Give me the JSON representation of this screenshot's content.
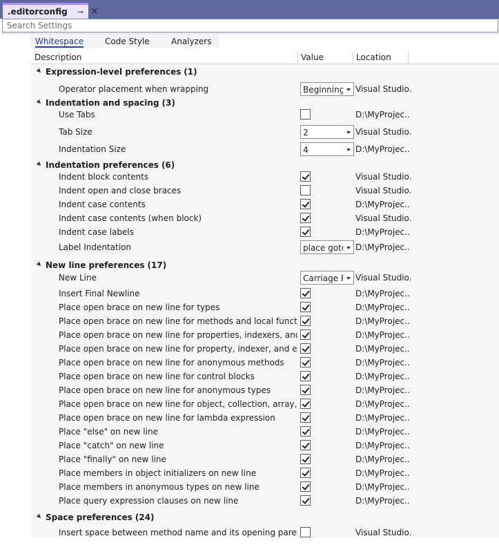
{
  "tab": {
    "title": ".editorconfig",
    "pin": "⊸",
    "close": "✕"
  },
  "search": {
    "placeholder": "Search Settings"
  },
  "tabs": [
    "Whitespace",
    "Code Style",
    "Analyzers"
  ],
  "columns": {
    "description": "Description",
    "value": "Value",
    "location": "Location"
  },
  "groups": [
    {
      "title": "Expression-level preferences",
      "count": "(1)",
      "items": [
        {
          "label": "Operator placement when wrapping",
          "type": "select",
          "value": "Beginning",
          "location": "Visual Studio..."
        }
      ]
    },
    {
      "title": "Indentation and spacing",
      "count": "(3)",
      "items": [
        {
          "label": "Use Tabs",
          "type": "check",
          "checked": false,
          "location": "D:\\MyProjec..."
        },
        {
          "label": "Tab Size",
          "type": "select",
          "value": "2",
          "location": "Visual Studio..."
        },
        {
          "label": "Indentation Size",
          "type": "select",
          "value": "4",
          "location": "D:\\MyProjec..."
        }
      ]
    },
    {
      "title": "Indentation preferences",
      "count": "(6)",
      "items": [
        {
          "label": "Indent block contents",
          "type": "check",
          "checked": true,
          "location": "Visual Studio..."
        },
        {
          "label": "Indent open and close braces",
          "type": "check",
          "checked": false,
          "location": "Visual Studio..."
        },
        {
          "label": "Indent case contents",
          "type": "check",
          "checked": true,
          "location": "D:\\MyProjec..."
        },
        {
          "label": "Indent case contents (when block)",
          "type": "check",
          "checked": true,
          "location": "Visual Studio..."
        },
        {
          "label": "Indent case labels",
          "type": "check",
          "checked": true,
          "location": "D:\\MyProjec..."
        },
        {
          "label": "Label Indentation",
          "type": "select",
          "value": "place goto",
          "location": "D:\\MyProjec..."
        }
      ]
    },
    {
      "title": "New line preferences",
      "count": "(17)",
      "items": [
        {
          "label": "New Line",
          "type": "select",
          "value": "Carriage Re",
          "location": "Visual Studio..."
        },
        {
          "label": "Insert Final Newline",
          "type": "check",
          "checked": true,
          "location": "D:\\MyProjec..."
        },
        {
          "label": "Place open brace on new line for types",
          "type": "check",
          "checked": true,
          "location": "D:\\MyProjec..."
        },
        {
          "label": "Place open brace on new line for methods and local functions",
          "type": "check",
          "checked": true,
          "location": "D:\\MyProjec..."
        },
        {
          "label": "Place open brace on new line for properties, indexers, and events",
          "type": "check",
          "checked": true,
          "location": "D:\\MyProjec..."
        },
        {
          "label": "Place open brace on new line for property, indexer, and event ac...",
          "type": "check",
          "checked": true,
          "location": "D:\\MyProjec..."
        },
        {
          "label": "Place open brace on new line for anonymous methods",
          "type": "check",
          "checked": true,
          "location": "D:\\MyProjec..."
        },
        {
          "label": "Place open brace on new line for control blocks",
          "type": "check",
          "checked": true,
          "location": "D:\\MyProjec..."
        },
        {
          "label": "Place open brace on new line for anonymous types",
          "type": "check",
          "checked": true,
          "location": "D:\\MyProjec..."
        },
        {
          "label": "Place open brace on new line for object, collection, array, and wi...",
          "type": "check",
          "checked": true,
          "location": "D:\\MyProjec..."
        },
        {
          "label": "Place open brace on new line for lambda expression",
          "type": "check",
          "checked": true,
          "location": "D:\\MyProjec..."
        },
        {
          "label": "Place \"else\" on new line",
          "type": "check",
          "checked": true,
          "location": "D:\\MyProjec..."
        },
        {
          "label": "Place \"catch\" on new line",
          "type": "check",
          "checked": true,
          "location": "D:\\MyProjec..."
        },
        {
          "label": "Place \"finally\" on new line",
          "type": "check",
          "checked": true,
          "location": "D:\\MyProjec..."
        },
        {
          "label": "Place members in object initializers on new line",
          "type": "check",
          "checked": true,
          "location": "D:\\MyProjec..."
        },
        {
          "label": "Place members in anonymous types on new line",
          "type": "check",
          "checked": true,
          "location": "D:\\MyProjec..."
        },
        {
          "label": "Place query expression clauses on new line",
          "type": "check",
          "checked": true,
          "location": "D:\\MyProjec..."
        }
      ]
    },
    {
      "title": "Space preferences",
      "count": "(24)",
      "items": [
        {
          "label": "Insert space between method name and its opening parenthesis",
          "type": "check",
          "checked": false,
          "location": "Visual Studio..."
        }
      ]
    }
  ]
}
